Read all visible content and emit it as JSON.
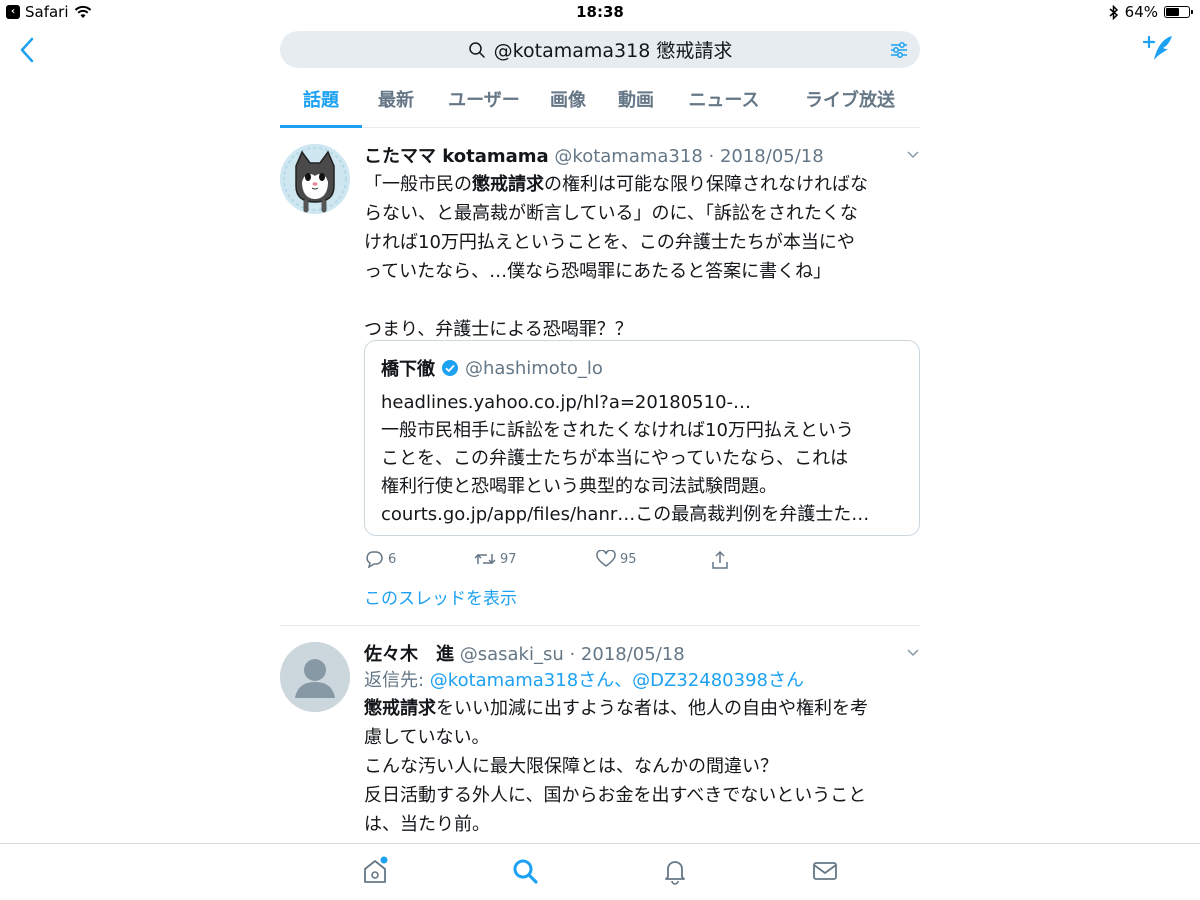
{
  "status_bar": {
    "app": "Safari",
    "time": "18:38",
    "battery": "64%",
    "battery_level": 0.64
  },
  "search": {
    "query": "@kotamama318 懲戒請求"
  },
  "tabs": [
    {
      "label": "話題",
      "active": true
    },
    {
      "label": "最新"
    },
    {
      "label": "ユーザー"
    },
    {
      "label": "画像"
    },
    {
      "label": "動画"
    },
    {
      "label": "ニュース"
    },
    {
      "label": "ライブ放送"
    }
  ],
  "tweet1": {
    "name": "こたママ kotamama",
    "meta": "@kotamama318 · 2018/05/18",
    "lines": [
      [
        "「一般市民の",
        "懲戒請求",
        "の権利は可能な限り保障されなければな"
      ],
      [
        "らない、と最高裁が断言している」のに、「訴訟をされたくな"
      ],
      [
        "ければ10万円払えということを、この弁護士たちが本当にや"
      ],
      [
        "っていたなら、…僕なら恐喝罪にあたると答案に書くね」"
      ],
      [
        ""
      ],
      [
        "つまり、弁護士による恐喝罪？？"
      ]
    ],
    "quote": {
      "name": "橋下徹",
      "handle": "@hashimoto_lo",
      "lines": [
        "headlines.yahoo.co.jp/hl?a=20180510-…",
        "一般市民相手に訴訟をされたくなければ10万円払えという",
        "ことを、この弁護士たちが本当にやっていたなら、これは",
        "権利行使と恐喝罪という典型的な司法試験問題。",
        "courts.go.jp/app/files/hanr…この最高裁判例を弁護士た…"
      ]
    },
    "actions": {
      "replies": "6",
      "retweets": "97",
      "likes": "95"
    },
    "thread_link": "このスレッドを表示"
  },
  "tweet2": {
    "name": "佐々木　進",
    "meta": "@sasaki_su · 2018/05/18",
    "reply_prefix": "返信先: ",
    "reply_targets": "@kotamama318さん、@DZ32480398さん",
    "lines": [
      [
        "",
        "懲戒請求",
        "をいい加減に出すような者は、他人の自由や権利を考"
      ],
      [
        "慮していない。"
      ],
      [
        "こんな汚い人に最大限保障とは、なんかの間違い？"
      ],
      [
        "反日活動する外人に、国からお金を出すべきでないということ"
      ],
      [
        "は、当たり前。"
      ]
    ]
  },
  "colors": {
    "accent": "#1da1f2",
    "muted": "#657786",
    "text": "#14171a"
  },
  "icons": [
    "wifi-icon",
    "bluetooth-icon",
    "back-chevron-icon",
    "search-icon",
    "filter-icon",
    "compose-tweet-icon",
    "chevron-down-icon",
    "verified-badge-icon",
    "reply-icon",
    "retweet-icon",
    "like-icon",
    "share-icon",
    "home-icon",
    "search-tab-icon",
    "notifications-icon",
    "messages-icon"
  ]
}
